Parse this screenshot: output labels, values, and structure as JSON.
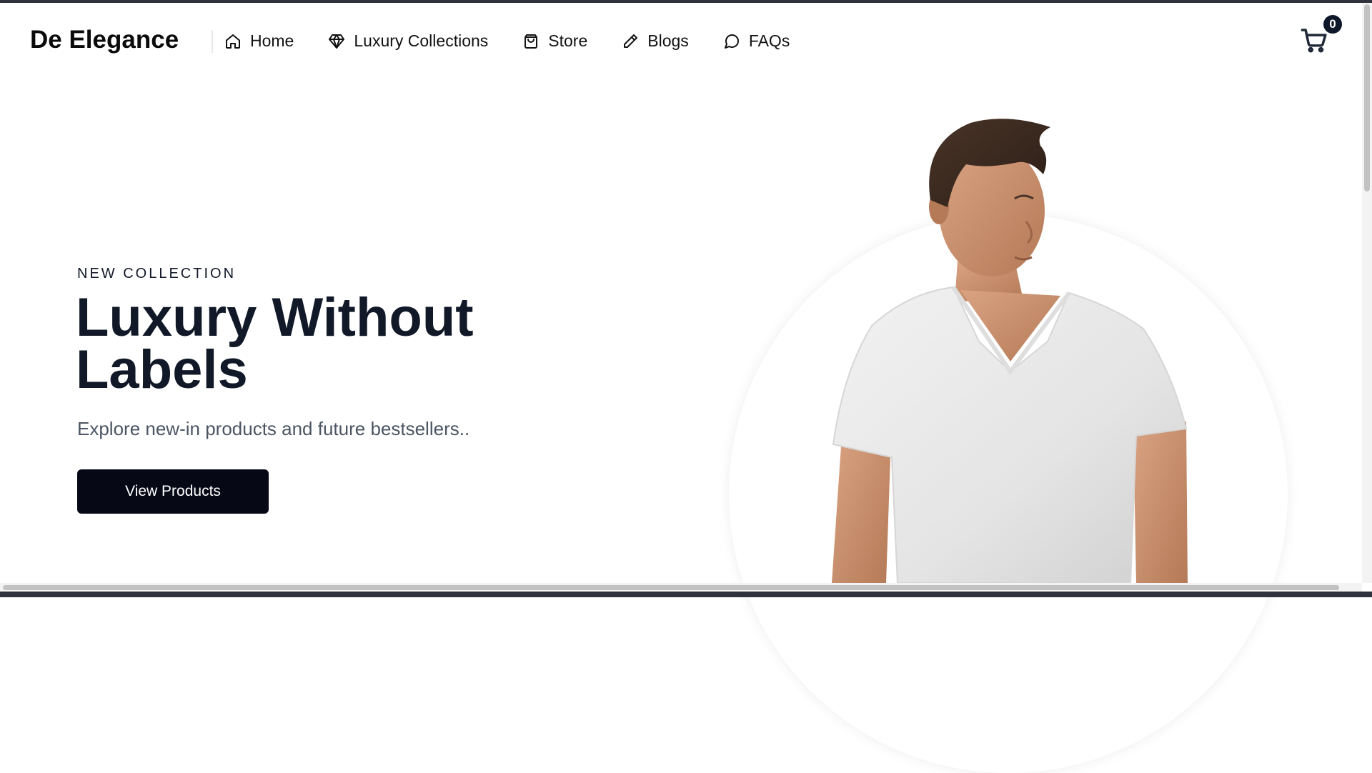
{
  "brand": "De Elegance",
  "nav": {
    "home": "Home",
    "luxury": "Luxury Collections",
    "store": "Store",
    "blogs": "Blogs",
    "faqs": "FAQs"
  },
  "cart": {
    "count": "0",
    "icon": "cart-icon"
  },
  "hero": {
    "kicker": "NEW COLLECTION",
    "title_line1": "Luxury Without",
    "title_line2": "Labels",
    "subtitle": "Explore new-in products and future bestsellers..",
    "cta": "View Products"
  },
  "colors": {
    "primary": "#060816",
    "title": "#111827",
    "subtitle": "#4b5563",
    "badge": "#0f172a"
  }
}
